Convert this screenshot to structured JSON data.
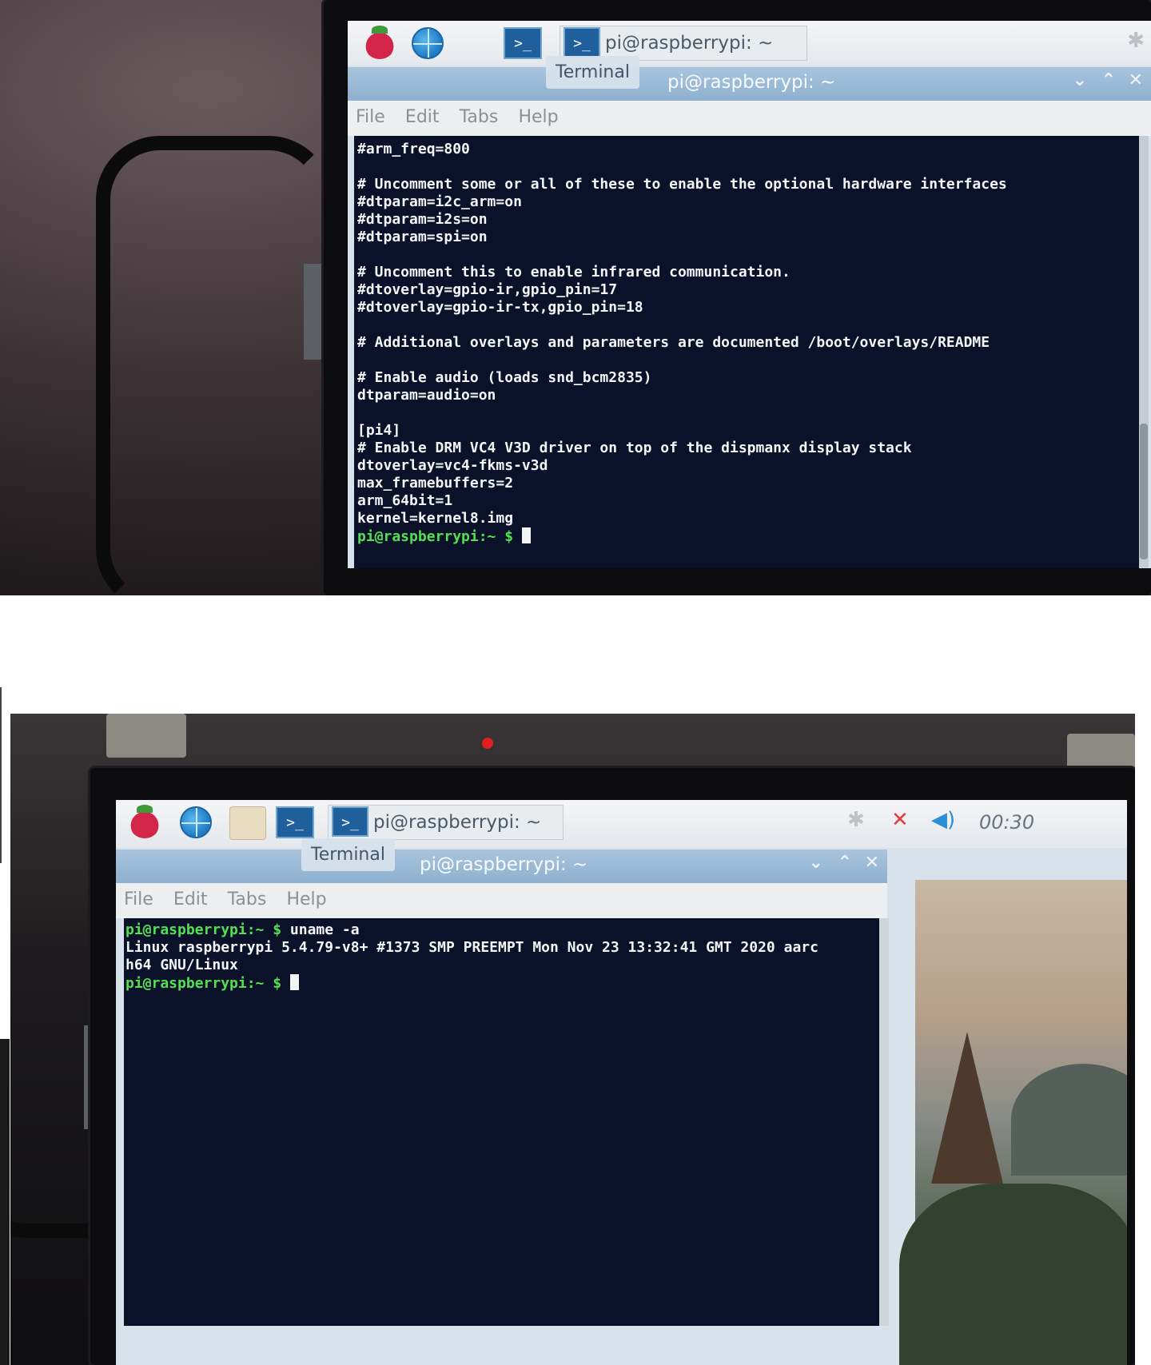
{
  "top": {
    "taskbar": {
      "task_button_label": "pi@raspberrypi: ~",
      "tooltip": "Terminal",
      "terminal_icon_glyph": ">_"
    },
    "window": {
      "title": "pi@raspberrypi: ~",
      "controls": {
        "minimize": "⌄",
        "maximize": "⌃",
        "close": "✕"
      }
    },
    "menu": {
      "file": "File",
      "edit": "Edit",
      "tabs": "Tabs",
      "help": "Help"
    },
    "terminal_lines": [
      "#arm_freq=800",
      "",
      "# Uncomment some or all of these to enable the optional hardware interfaces",
      "#dtparam=i2c_arm=on",
      "#dtparam=i2s=on",
      "#dtparam=spi=on",
      "",
      "# Uncomment this to enable infrared communication.",
      "#dtoverlay=gpio-ir,gpio_pin=17",
      "#dtoverlay=gpio-ir-tx,gpio_pin=18",
      "",
      "# Additional overlays and parameters are documented /boot/overlays/README",
      "",
      "# Enable audio (loads snd_bcm2835)",
      "dtparam=audio=on",
      "",
      "[pi4]",
      "# Enable DRM VC4 V3D driver on top of the dispmanx display stack",
      "dtoverlay=vc4-fkms-v3d",
      "max_framebuffers=2",
      "arm_64bit=1",
      "kernel=kernel8.img"
    ],
    "prompt": "pi@raspberrypi:~ $",
    "icons": {
      "bluetooth": "bluetooth-icon"
    }
  },
  "bottom": {
    "taskbar": {
      "task_button_label": "pi@raspberrypi: ~",
      "tooltip": "Terminal",
      "terminal_icon_glyph": ">_",
      "clock": "00:30"
    },
    "window": {
      "title": "pi@raspberrypi: ~",
      "controls": {
        "minimize": "⌄",
        "maximize": "⌃",
        "close": "✕"
      }
    },
    "menu": {
      "file": "File",
      "edit": "Edit",
      "tabs": "Tabs",
      "help": "Help"
    },
    "prompt": "pi@raspberrypi:~ $",
    "command": " uname -a",
    "output_lines": [
      "Linux raspberrypi 5.4.79-v8+ #1373 SMP PREEMPT Mon Nov 23 13:32:41 GMT 2020 aarc",
      "h64 GNU/Linux"
    ],
    "icons": {
      "bluetooth": "bluetooth-icon",
      "network": "network-disconnected-icon",
      "volume": "volume-icon"
    }
  },
  "colors": {
    "terminal_bg": "#0b1129",
    "prompt_green": "#52e052",
    "titlebar": "#9bbad6"
  }
}
